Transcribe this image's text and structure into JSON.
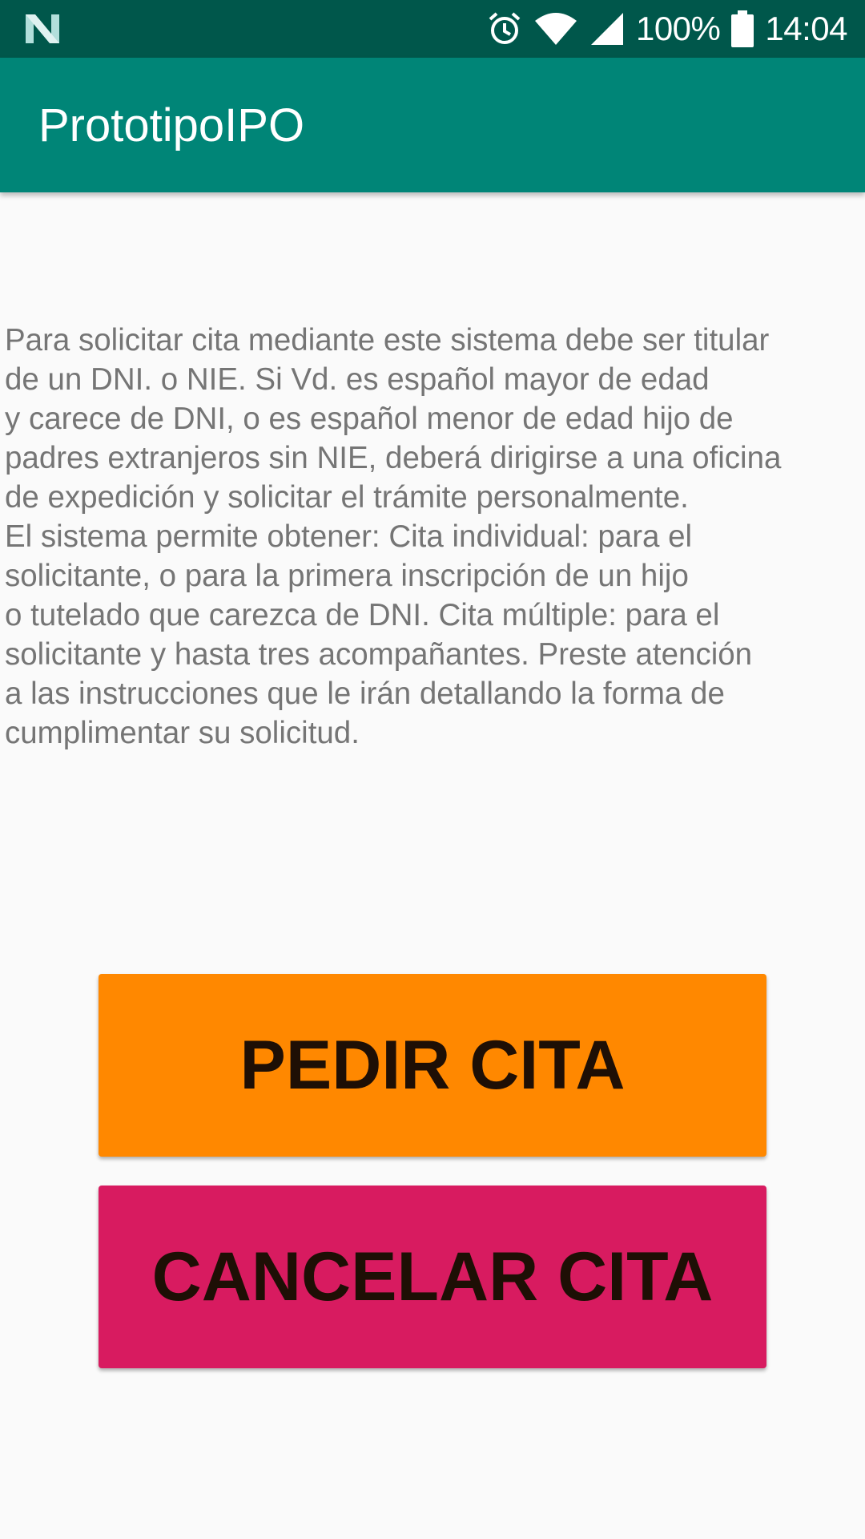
{
  "status_bar": {
    "battery_percent": "100%",
    "time": "14:04",
    "icons": [
      "n-logo-icon",
      "alarm-icon",
      "wifi-icon",
      "signal-icon",
      "battery-icon"
    ]
  },
  "app_bar": {
    "title": "PrototipoIPO"
  },
  "main": {
    "info_text": "Para solicitar cita mediante este sistema debe ser titular\nde un DNI. o NIE.  Si Vd. es español mayor de edad\ny carece de DNI, o es español menor de edad hijo de\npadres extranjeros sin NIE, deberá dirigirse a una oficina\nde expedición y solicitar el trámite personalmente.\nEl sistema permite obtener: Cita individual: para el\nsolicitante, o para la primera inscripción de un hijo\no tutelado que carezca de DNI. Cita múltiple: para el\nsolicitante y hasta tres acompañantes.  Preste atención\na las instrucciones que le irán detallando la forma de\ncumplimentar su solicitud.",
    "pedir_cita_label": "PEDIR CITA",
    "cancelar_cita_label": "CANCELAR CITA"
  },
  "colors": {
    "status_bar": "#00574b",
    "app_bar": "#008577",
    "background": "#fafafa",
    "pedir_button": "#ff8800",
    "cancelar_button": "#d81b60",
    "info_text": "#757575"
  }
}
